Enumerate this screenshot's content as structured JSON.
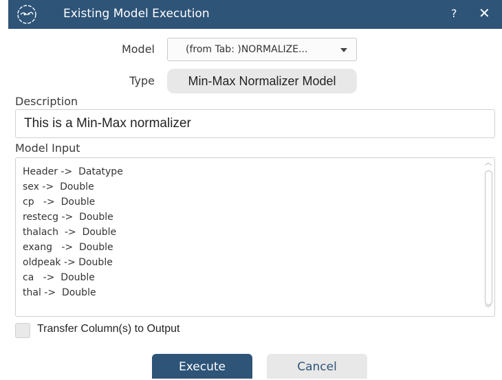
{
  "window": {
    "title": "Existing Model Execution",
    "help_label": "?",
    "close_label": "✕",
    "logo_icon": "globe-logo-icon",
    "titlebar_color": "#2e5478"
  },
  "form": {
    "model_label": "Model",
    "model_value": "(from Tab: )NORMALIZE...",
    "type_label": "Type",
    "type_value": "Min-Max Normalizer Model",
    "description_label": "Description",
    "description_value": "This is a Min-Max normalizer",
    "model_input_label": "Model Input",
    "model_input_lines": [
      "Header ->  Datatype",
      "sex ->  Double",
      "cp   ->  Double",
      "restecg ->  Double",
      "thalach  ->  Double",
      "exang   ->  Double",
      "oldpeak -> Double",
      "ca   ->  Double",
      "thal ->  Double"
    ],
    "transfer_label": "Transfer Column(s) to Output",
    "transfer_checked": false
  },
  "buttons": {
    "execute": "Execute",
    "cancel": "Cancel"
  }
}
